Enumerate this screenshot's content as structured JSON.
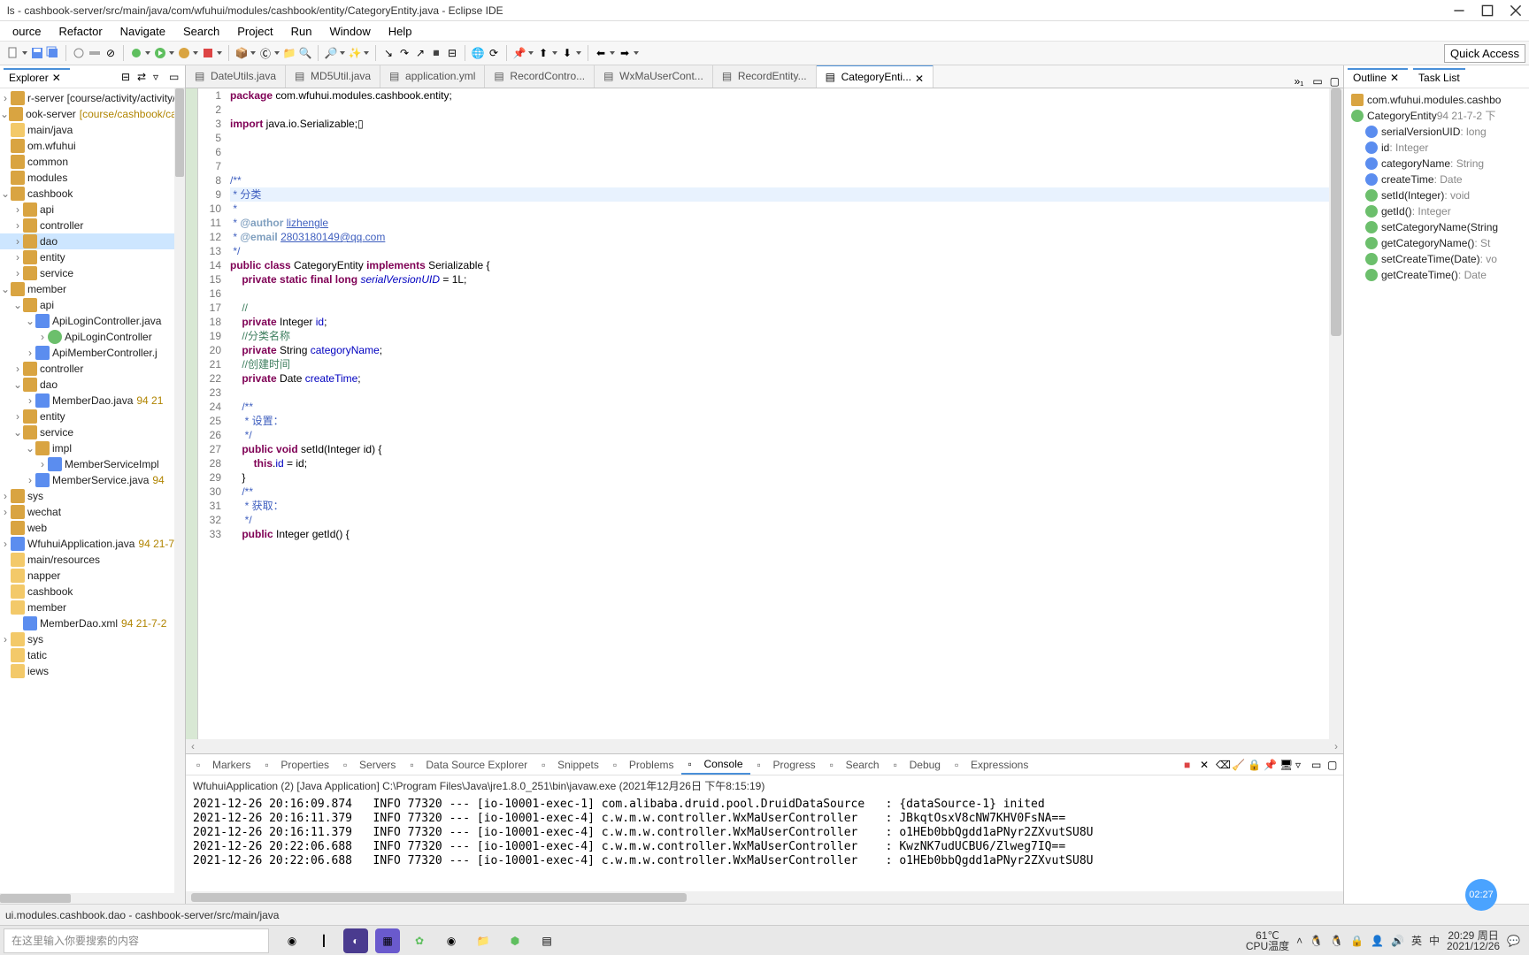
{
  "window": {
    "title": "ls - cashbook-server/src/main/java/com/wfuhui/modules/cashbook/entity/CategoryEntity.java - Eclipse IDE"
  },
  "menu": [
    "ource",
    "Refactor",
    "Navigate",
    "Search",
    "Project",
    "Run",
    "Window",
    "Help"
  ],
  "quick_access": "Quick Access",
  "explorer": {
    "title": "Explorer",
    "rows": [
      {
        "indent": 0,
        "tw": ">",
        "ico": "pkg",
        "label": "r-server [course/activity/activity/a",
        "deco": ""
      },
      {
        "indent": 0,
        "tw": "v",
        "ico": "pkg",
        "label": "ook-server",
        "deco": "[course/cashbook/cash"
      },
      {
        "indent": 0,
        "tw": " ",
        "ico": "fld",
        "label": "main/java",
        "deco": ""
      },
      {
        "indent": 0,
        "tw": " ",
        "ico": "pkg",
        "label": "om.wfuhui",
        "deco": ""
      },
      {
        "indent": 0,
        "tw": " ",
        "ico": "pkg",
        "label": "common",
        "deco": ""
      },
      {
        "indent": 0,
        "tw": " ",
        "ico": "pkg",
        "label": "modules",
        "deco": ""
      },
      {
        "indent": 0,
        "tw": "v",
        "ico": "pkg",
        "label": "cashbook",
        "deco": ""
      },
      {
        "indent": 1,
        "tw": ">",
        "ico": "pkg",
        "label": "api",
        "deco": ""
      },
      {
        "indent": 1,
        "tw": ">",
        "ico": "pkg",
        "label": "controller",
        "deco": ""
      },
      {
        "indent": 1,
        "tw": ">",
        "ico": "pkg",
        "label": "dao",
        "deco": "",
        "sel": true
      },
      {
        "indent": 1,
        "tw": ">",
        "ico": "pkg",
        "label": "entity",
        "deco": ""
      },
      {
        "indent": 1,
        "tw": ">",
        "ico": "pkg",
        "label": "service",
        "deco": ""
      },
      {
        "indent": 0,
        "tw": "v",
        "ico": "pkg",
        "label": "member",
        "deco": ""
      },
      {
        "indent": 1,
        "tw": "v",
        "ico": "pkg",
        "label": "api",
        "deco": ""
      },
      {
        "indent": 2,
        "tw": "v",
        "ico": "java",
        "label": "ApiLoginController.java",
        "deco": ""
      },
      {
        "indent": 3,
        "tw": ">",
        "ico": "cls",
        "label": "ApiLoginController",
        "deco": ""
      },
      {
        "indent": 2,
        "tw": ">",
        "ico": "java",
        "label": "ApiMemberController.j",
        "deco": ""
      },
      {
        "indent": 1,
        "tw": ">",
        "ico": "pkg",
        "label": "controller",
        "deco": ""
      },
      {
        "indent": 1,
        "tw": "v",
        "ico": "pkg",
        "label": "dao",
        "deco": ""
      },
      {
        "indent": 2,
        "tw": ">",
        "ico": "java",
        "label": "MemberDao.java",
        "deco": "94  21"
      },
      {
        "indent": 1,
        "tw": ">",
        "ico": "pkg",
        "label": "entity",
        "deco": ""
      },
      {
        "indent": 1,
        "tw": "v",
        "ico": "pkg",
        "label": "service",
        "deco": ""
      },
      {
        "indent": 2,
        "tw": "v",
        "ico": "pkg",
        "label": "impl",
        "deco": ""
      },
      {
        "indent": 3,
        "tw": ">",
        "ico": "java",
        "label": "MemberServiceImpl",
        "deco": ""
      },
      {
        "indent": 2,
        "tw": ">",
        "ico": "java",
        "label": "MemberService.java",
        "deco": "94"
      },
      {
        "indent": 0,
        "tw": ">",
        "ico": "pkg",
        "label": "sys",
        "deco": ""
      },
      {
        "indent": 0,
        "tw": ">",
        "ico": "pkg",
        "label": "wechat",
        "deco": ""
      },
      {
        "indent": 0,
        "tw": " ",
        "ico": "pkg",
        "label": "web",
        "deco": ""
      },
      {
        "indent": 0,
        "tw": ">",
        "ico": "java",
        "label": "WfuhuiApplication.java",
        "deco": "94  21-7"
      },
      {
        "indent": 0,
        "tw": " ",
        "ico": "fld",
        "label": "main/resources",
        "deco": ""
      },
      {
        "indent": 0,
        "tw": " ",
        "ico": "fld",
        "label": "napper",
        "deco": ""
      },
      {
        "indent": 0,
        "tw": " ",
        "ico": "fld",
        "label": "cashbook",
        "deco": ""
      },
      {
        "indent": 0,
        "tw": " ",
        "ico": "fld",
        "label": "member",
        "deco": ""
      },
      {
        "indent": 1,
        "tw": " ",
        "ico": "java",
        "label": "MemberDao.xml",
        "deco": "94  21-7-2"
      },
      {
        "indent": 0,
        "tw": ">",
        "ico": "fld",
        "label": "sys",
        "deco": ""
      },
      {
        "indent": 0,
        "tw": " ",
        "ico": "fld",
        "label": "tatic",
        "deco": ""
      },
      {
        "indent": 0,
        "tw": " ",
        "ico": "fld",
        "label": "iews",
        "deco": ""
      }
    ]
  },
  "editor_tabs": [
    {
      "label": "DateUtils.java",
      "active": false
    },
    {
      "label": "MD5Util.java",
      "active": false
    },
    {
      "label": "application.yml",
      "active": false
    },
    {
      "label": "RecordContro...",
      "active": false
    },
    {
      "label": "WxMaUserCont...",
      "active": false
    },
    {
      "label": "RecordEntity...",
      "active": false
    },
    {
      "label": "CategoryEnti...",
      "active": true
    }
  ],
  "code_lines": [
    {
      "n": "1",
      "html": "<span class='kw'>package</span> com.wfuhui.modules.cashbook.entity;"
    },
    {
      "n": "2",
      "html": ""
    },
    {
      "n": "3",
      "html": "<span class='kw'>import</span> java.io.Serializable;▯",
      "fold": "+"
    },
    {
      "n": "5",
      "html": ""
    },
    {
      "n": "6",
      "html": ""
    },
    {
      "n": "7",
      "html": ""
    },
    {
      "n": "8",
      "html": "<span class='doc'>/**</span>",
      "fold": "-"
    },
    {
      "n": "9",
      "html": "<span class='doc'> * 分类</span>",
      "hl": true
    },
    {
      "n": "10",
      "html": "<span class='doc'> *</span>"
    },
    {
      "n": "11",
      "html": "<span class='doc'> * <span class='tag'>@author</span> <span class='link'>lizhengle</span></span>"
    },
    {
      "n": "12",
      "html": "<span class='doc'> * <span class='tag'>@email</span> <span class='link'>2803180149@qq.com</span></span>"
    },
    {
      "n": "13",
      "html": "<span class='doc'> */</span>"
    },
    {
      "n": "14",
      "html": "<span class='kw'>public</span> <span class='kw'>class</span> CategoryEntity <span class='kw'>implements</span> Serializable {"
    },
    {
      "n": "15",
      "html": "    <span class='kw'>private</span> <span class='kw'>static</span> <span class='kw'>final</span> <span class='kw'>long</span> <span class='it'>serialVersionUID</span> = 1L;"
    },
    {
      "n": "16",
      "html": ""
    },
    {
      "n": "17",
      "html": "    <span class='cm'>//</span>"
    },
    {
      "n": "18",
      "html": "    <span class='kw'>private</span> Integer <span class='fld'>id</span>;"
    },
    {
      "n": "19",
      "html": "    <span class='cm'>//分类名称</span>"
    },
    {
      "n": "20",
      "html": "    <span class='kw'>private</span> String <span class='fld'>categoryName</span>;"
    },
    {
      "n": "21",
      "html": "    <span class='cm'>//创建时间</span>"
    },
    {
      "n": "22",
      "html": "    <span class='kw'>private</span> Date <span class='fld'>createTime</span>;"
    },
    {
      "n": "23",
      "html": ""
    },
    {
      "n": "24",
      "html": "    <span class='doc'>/**</span>",
      "fold": "-"
    },
    {
      "n": "25",
      "html": "    <span class='doc'> * 设置：</span>"
    },
    {
      "n": "26",
      "html": "    <span class='doc'> */</span>"
    },
    {
      "n": "27",
      "html": "    <span class='kw'>public</span> <span class='kw'>void</span> setId(Integer id) {",
      "fold": "-"
    },
    {
      "n": "28",
      "html": "        <span class='kw'>this</span>.<span class='fld'>id</span> = id;"
    },
    {
      "n": "29",
      "html": "    }"
    },
    {
      "n": "30",
      "html": "    <span class='doc'>/**</span>",
      "fold": "-"
    },
    {
      "n": "31",
      "html": "    <span class='doc'> * 获取：</span>"
    },
    {
      "n": "32",
      "html": "    <span class='doc'> */</span>"
    },
    {
      "n": "33",
      "html": "    <span class='kw'>public</span> Integer getId() {",
      "fold": "-"
    }
  ],
  "outline": {
    "title": "Outline",
    "task_list": "Task List",
    "rows": [
      {
        "indent": 0,
        "ico": "pkg",
        "name": "com.wfuhui.modules.cashbo",
        "type": ""
      },
      {
        "indent": 0,
        "ico": "green",
        "name": "CategoryEntity",
        "type": "94  21-7-2 下"
      },
      {
        "indent": 1,
        "ico": "blue",
        "name": "serialVersionUID",
        "type": ": long"
      },
      {
        "indent": 1,
        "ico": "blue",
        "name": "id",
        "type": ": Integer"
      },
      {
        "indent": 1,
        "ico": "blue",
        "name": "categoryName",
        "type": ": String"
      },
      {
        "indent": 1,
        "ico": "blue",
        "name": "createTime",
        "type": ": Date"
      },
      {
        "indent": 1,
        "ico": "green",
        "name": "setId(Integer)",
        "type": ": void"
      },
      {
        "indent": 1,
        "ico": "green",
        "name": "getId()",
        "type": ": Integer"
      },
      {
        "indent": 1,
        "ico": "green",
        "name": "setCategoryName(String",
        "type": ""
      },
      {
        "indent": 1,
        "ico": "green",
        "name": "getCategoryName()",
        "type": ": St"
      },
      {
        "indent": 1,
        "ico": "green",
        "name": "setCreateTime(Date)",
        "type": ": vo"
      },
      {
        "indent": 1,
        "ico": "green",
        "name": "getCreateTime()",
        "type": ": Date"
      }
    ]
  },
  "bottom": {
    "tabs": [
      "Markers",
      "Properties",
      "Servers",
      "Data Source Explorer",
      "Snippets",
      "Problems",
      "Console",
      "Progress",
      "Search",
      "Debug",
      "Expressions"
    ],
    "active_tab": "Console",
    "title": "WfuhuiApplication (2) [Java Application] C:\\Program Files\\Java\\jre1.8.0_251\\bin\\javaw.exe (2021年12月26日 下午8:15:19)",
    "lines": [
      "2021-12-26 20:16:09.874   INFO 77320 --- [io-10001-exec-1] com.alibaba.druid.pool.DruidDataSource   : {dataSource-1} inited",
      "2021-12-26 20:16:11.379   INFO 77320 --- [io-10001-exec-4] c.w.m.w.controller.WxMaUserController    : JBkqtOsxV8cNW7KHV0FsNA==",
      "2021-12-26 20:16:11.379   INFO 77320 --- [io-10001-exec-4] c.w.m.w.controller.WxMaUserController    : o1HEb0bbQgdd1aPNyr2ZXvutSU8U",
      "2021-12-26 20:22:06.688   INFO 77320 --- [io-10001-exec-4] c.w.m.w.controller.WxMaUserController    : KwzNK7udUCBU6/Zlweg7IQ==",
      "2021-12-26 20:22:06.688   INFO 77320 --- [io-10001-exec-4] c.w.m.w.controller.WxMaUserController    : o1HEb0bbQgdd1aPNyr2ZXvutSU8U"
    ]
  },
  "statusbar": "ui.modules.cashbook.dao - cashbook-server/src/main/java",
  "taskbar": {
    "search_placeholder": "在这里输入你要搜索的内容",
    "temp": "61℃",
    "cpu": "CPU温度",
    "ime1": "英",
    "ime2": "中",
    "time": "20:29 周日",
    "date": "2021/12/26"
  },
  "clock_badge": "02:27"
}
